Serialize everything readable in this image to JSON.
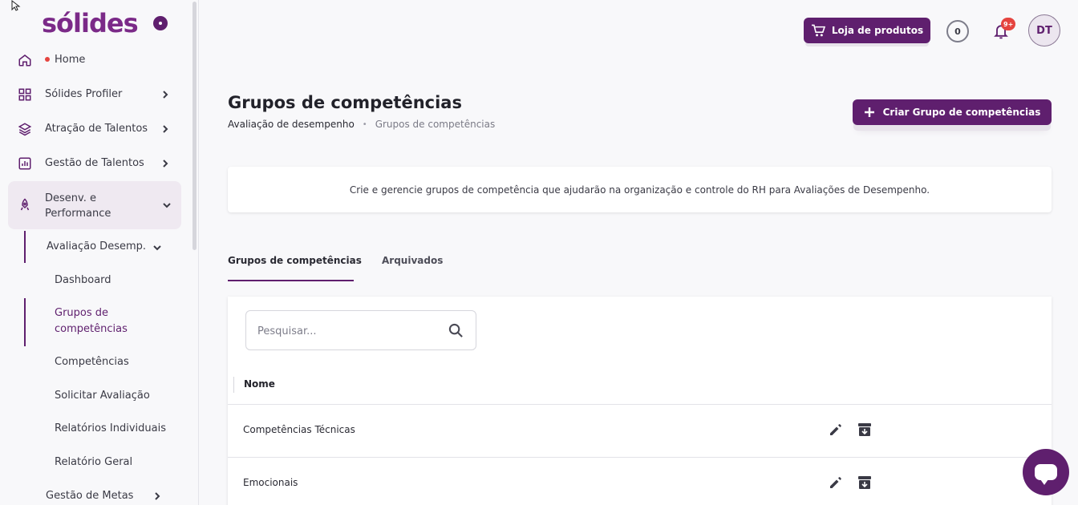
{
  "brand": {
    "logo_text": "sólides"
  },
  "sidebar": {
    "items": [
      {
        "label": "Home",
        "icon": "home-icon",
        "has_dot": true
      },
      {
        "label": "Sólides Profiler",
        "icon": "grid-icon"
      },
      {
        "label": "Atração de Talentos",
        "icon": "layers-icon"
      },
      {
        "label": "Gestão de Talentos",
        "icon": "chart-icon"
      },
      {
        "label_line1": "Desenv. e",
        "label_line2": "Performance",
        "icon": "rocket-icon",
        "expanded": true
      }
    ],
    "submenu": {
      "label": "Avaliação Desemp.",
      "children": [
        {
          "label": "Dashboard"
        },
        {
          "label_line1": "Grupos de",
          "label_line2": "competências",
          "active": true
        },
        {
          "label": "Competências"
        },
        {
          "label": "Solicitar Avaliação"
        },
        {
          "label": "Relatórios Individuais"
        },
        {
          "label": "Relatório Geral"
        }
      ],
      "next": "Gestão de Metas"
    }
  },
  "header": {
    "shop_label": "Loja de produtos",
    "coin_count": "0",
    "notif_badge": "9+",
    "avatar_initials": "DT"
  },
  "page": {
    "title": "Grupos de competências",
    "breadcrumb": [
      "Avaliação de desempenho",
      "Grupos de competências"
    ],
    "create_label": "Criar Grupo de competências",
    "info_text": "Crie e gerencie grupos de competência que ajudarão na organização e controle do RH para Avaliações de Desempenho."
  },
  "tabs": [
    {
      "label": "Grupos de competências",
      "active": true
    },
    {
      "label": "Arquivados"
    }
  ],
  "table": {
    "search_placeholder": "Pesquisar...",
    "columns": [
      "Nome"
    ],
    "rows": [
      {
        "name": "Competências Técnicas"
      },
      {
        "name": "Emocionais"
      }
    ]
  },
  "colors": {
    "accent": "#5f1f6e",
    "logo": "#7b2a88",
    "badge": "#e5443f"
  }
}
